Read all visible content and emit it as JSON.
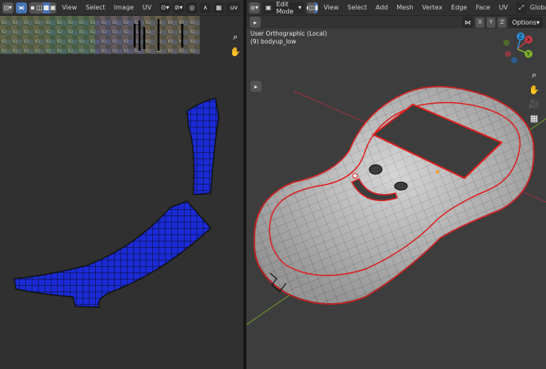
{
  "uv_editor": {
    "menus": [
      "View",
      "Select",
      "Image",
      "UV"
    ],
    "uv_map_label": "uv"
  },
  "viewport": {
    "mode": "Edit Mode",
    "menus": [
      "View",
      "Select",
      "Add",
      "Mesh",
      "Vertex",
      "Edge",
      "Face",
      "UV"
    ],
    "orientation": "Global",
    "view_name": "User Orthographic (Local)",
    "object_name": "(9) bodyup_low",
    "options_label": "Options",
    "axis_x": "X",
    "axis_y": "Y",
    "axis_z": "Z"
  },
  "gizmo": {
    "x": "X",
    "y": "Y",
    "z": "Z"
  },
  "colors": {
    "uv_face": "#1a2bd6",
    "seam": "#e01818",
    "accent": "#4772b3",
    "x_axis": "#c73845",
    "y_axis": "#7aaf27",
    "z_axis": "#2c8fd6"
  }
}
